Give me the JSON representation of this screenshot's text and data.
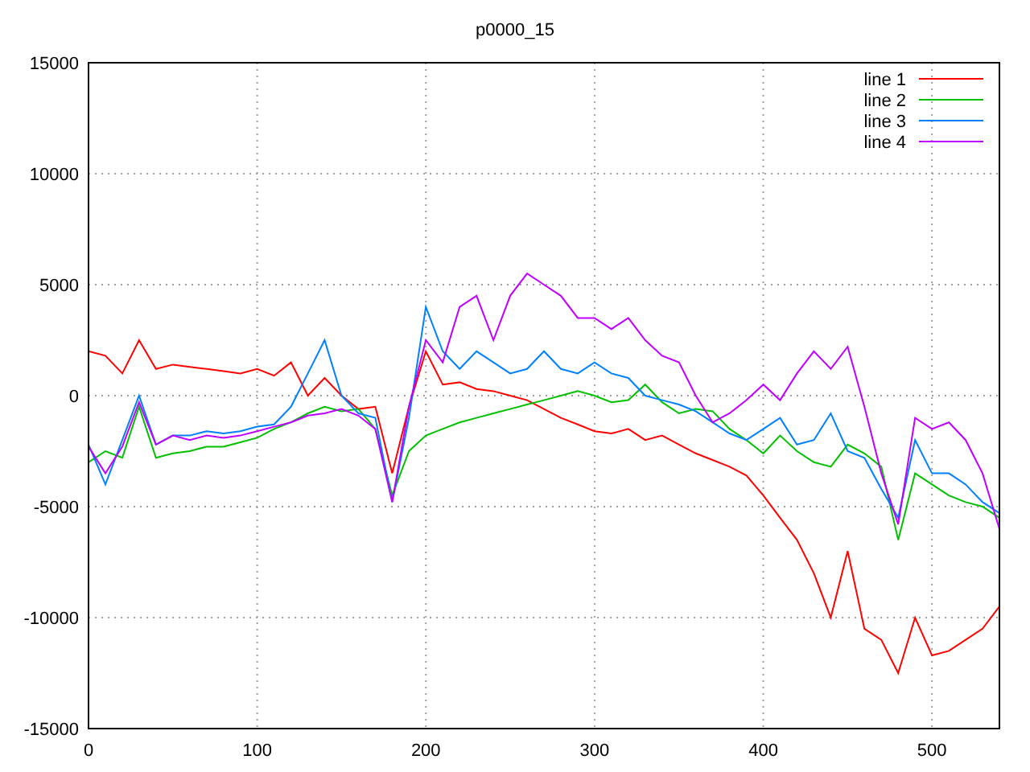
{
  "chart": {
    "chart_data": {
      "type": "line",
      "title": "p0000_15",
      "x": [
        0,
        10,
        20,
        30,
        40,
        50,
        60,
        70,
        80,
        90,
        100,
        110,
        120,
        130,
        140,
        150,
        160,
        170,
        180,
        190,
        200,
        210,
        220,
        230,
        240,
        250,
        260,
        270,
        280,
        290,
        300,
        310,
        320,
        330,
        340,
        350,
        360,
        370,
        380,
        390,
        400,
        410,
        420,
        430,
        440,
        450,
        460,
        470,
        480,
        490,
        500,
        510,
        520,
        530,
        540
      ],
      "series": [
        {
          "name": "line 1",
          "color": "#ff0000",
          "values": [
            2000,
            1800,
            1000,
            2500,
            1200,
            1400,
            1300,
            1200,
            1100,
            1000,
            1200,
            900,
            1500,
            0,
            800,
            0,
            -600,
            -500,
            -3500,
            -500,
            2000,
            500,
            600,
            300,
            200,
            0,
            -200,
            -600,
            -1000,
            -1300,
            -1600,
            -1700,
            -1500,
            -2000,
            -1800,
            -2200,
            -2600,
            -2900,
            -3200,
            -3600,
            -4500,
            -5500,
            -6500,
            -8000,
            -10000,
            -7000,
            -10500,
            -11000,
            -12500,
            -10000,
            -11700,
            -11500,
            -11000,
            -10500,
            -9500
          ]
        },
        {
          "name": "line 2",
          "color": "#00c000",
          "values": [
            -3000,
            -2500,
            -2800,
            -500,
            -2800,
            -2600,
            -2500,
            -2300,
            -2300,
            -2100,
            -1900,
            -1500,
            -1200,
            -800,
            -500,
            -700,
            -600,
            -1500,
            -4500,
            -2500,
            -1800,
            -1500,
            -1200,
            -1000,
            -800,
            -600,
            -400,
            -200,
            0,
            200,
            0,
            -300,
            -200,
            500,
            -300,
            -800,
            -600,
            -700,
            -1500,
            -2000,
            -2600,
            -1800,
            -2500,
            -3000,
            -3200,
            -2200,
            -2600,
            -3200,
            -6500,
            -3500,
            -4000,
            -4500,
            -4800,
            -5000,
            -5500
          ]
        },
        {
          "name": "line 3",
          "color": "#0080ff",
          "values": [
            -2200,
            -4000,
            -2000,
            0,
            -2200,
            -1800,
            -1800,
            -1600,
            -1700,
            -1600,
            -1400,
            -1300,
            -500,
            1000,
            2500,
            0,
            -800,
            -1000,
            -4800,
            -1000,
            4000,
            2000,
            1200,
            2000,
            1500,
            1000,
            1200,
            2000,
            1200,
            1000,
            1500,
            1000,
            800,
            0,
            -200,
            -400,
            -700,
            -1200,
            -1700,
            -2000,
            -1500,
            -1000,
            -2200,
            -2000,
            -800,
            -2500,
            -2800,
            -4200,
            -5500,
            -2000,
            -3500,
            -3500,
            -4000,
            -4800,
            -5300
          ]
        },
        {
          "name": "line 4",
          "color": "#c000ff",
          "values": [
            -2300,
            -3500,
            -2300,
            -300,
            -2200,
            -1800,
            -2000,
            -1800,
            -1900,
            -1800,
            -1600,
            -1400,
            -1200,
            -900,
            -800,
            -600,
            -900,
            -1500,
            -4800,
            -500,
            2500,
            1500,
            4000,
            4500,
            2500,
            4500,
            5500,
            5000,
            4500,
            3500,
            3500,
            3000,
            3500,
            2500,
            1800,
            1500,
            0,
            -1200,
            -800,
            -200,
            500,
            -200,
            1000,
            2000,
            1200,
            2200,
            -500,
            -3500,
            -5800,
            -1000,
            -1500,
            -1200,
            -2000,
            -3500,
            -6000
          ]
        }
      ],
      "xlim": [
        0,
        540
      ],
      "ylim": [
        -15000,
        15000
      ],
      "xticks": [
        0,
        100,
        200,
        300,
        400,
        500
      ],
      "yticks": [
        -15000,
        -10000,
        -5000,
        0,
        5000,
        10000,
        15000
      ],
      "grid": true,
      "legend": true
    }
  }
}
